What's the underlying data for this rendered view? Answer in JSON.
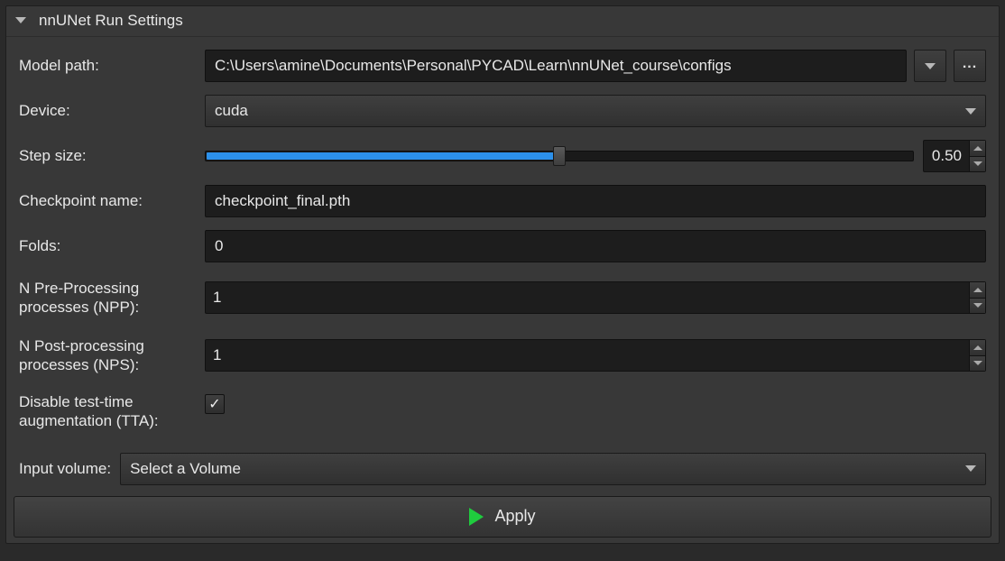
{
  "panel_title": "nnUNet Run Settings",
  "labels": {
    "model_path": "Model path:",
    "device": "Device:",
    "step_size": "Step size:",
    "checkpoint_name": "Checkpoint name:",
    "folds": "Folds:",
    "npp": "N Pre-Processing processes (NPP):",
    "nps": "N Post-processing processes (NPS):",
    "tta": "Disable test-time augmentation (TTA):",
    "input_volume": "Input volume:"
  },
  "values": {
    "model_path": "C:\\Users\\amine\\Documents\\Personal\\PYCAD\\Learn\\nnUNet_course\\configs",
    "device": "cuda",
    "step_size": "0.50",
    "checkpoint_name": "checkpoint_final.pth",
    "folds": "0",
    "npp": "1",
    "nps": "1",
    "tta_checked": true,
    "input_volume": "Select a Volume"
  },
  "browse_label": "...",
  "apply_label": "Apply",
  "checkmark": "✓"
}
